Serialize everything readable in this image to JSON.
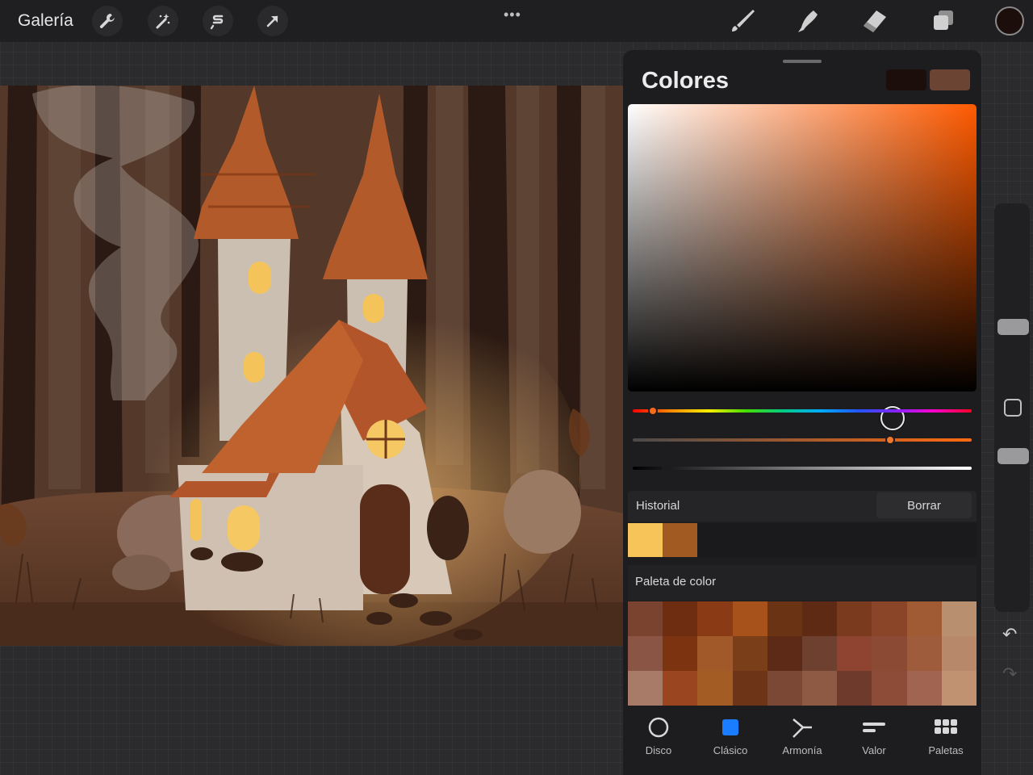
{
  "toolbar": {
    "gallery_label": "Galería",
    "left_icons": [
      "wrench-icon",
      "magic-wand-icon",
      "selection-icon",
      "transform-arrow-icon"
    ],
    "right_icons": [
      "brush-icon",
      "smudge-icon",
      "eraser-icon",
      "layers-icon"
    ],
    "current_color": "#1c0e0a"
  },
  "panel": {
    "title": "Colores",
    "primary_swatch": "#1c0e0a",
    "secondary_swatch": "#6b4434",
    "hue_color": "#ff5a00",
    "history_label": "Historial",
    "clear_label": "Borrar",
    "history_colors": [
      "#f7c45a",
      "#a25a23"
    ],
    "palette_label": "Paleta de color",
    "palette_colors": [
      "#7a4330",
      "#6e2d10",
      "#8a3a14",
      "#a8521b",
      "#6a3414",
      "#5e2a14",
      "#7a3a1e",
      "#8a4428",
      "#a05a34",
      "#b89070",
      "#8a5544",
      "#7c3410",
      "#a2592a",
      "#7a3f18",
      "#5e2a18",
      "#6e4030",
      "#8e4430",
      "#8a4a34",
      "#9e5c3c",
      "#b8886a",
      "#a87a68",
      "#9a4420",
      "#a25c24",
      "#6e3418",
      "#7a4834",
      "#8e5a44",
      "#6e3a2c",
      "#8c4c38",
      "#a06450",
      "#c09272"
    ]
  },
  "tabs": [
    {
      "label": "Disco",
      "icon": "disc-icon"
    },
    {
      "label": "Clásico",
      "icon": "classic-square-icon"
    },
    {
      "label": "Armonía",
      "icon": "harmony-icon"
    },
    {
      "label": "Valor",
      "icon": "value-sliders-icon"
    },
    {
      "label": "Paletas",
      "icon": "palettes-grid-icon"
    }
  ],
  "sliders": {
    "hue": 0.06,
    "saturation": 0.76,
    "brightness": 0.1
  }
}
